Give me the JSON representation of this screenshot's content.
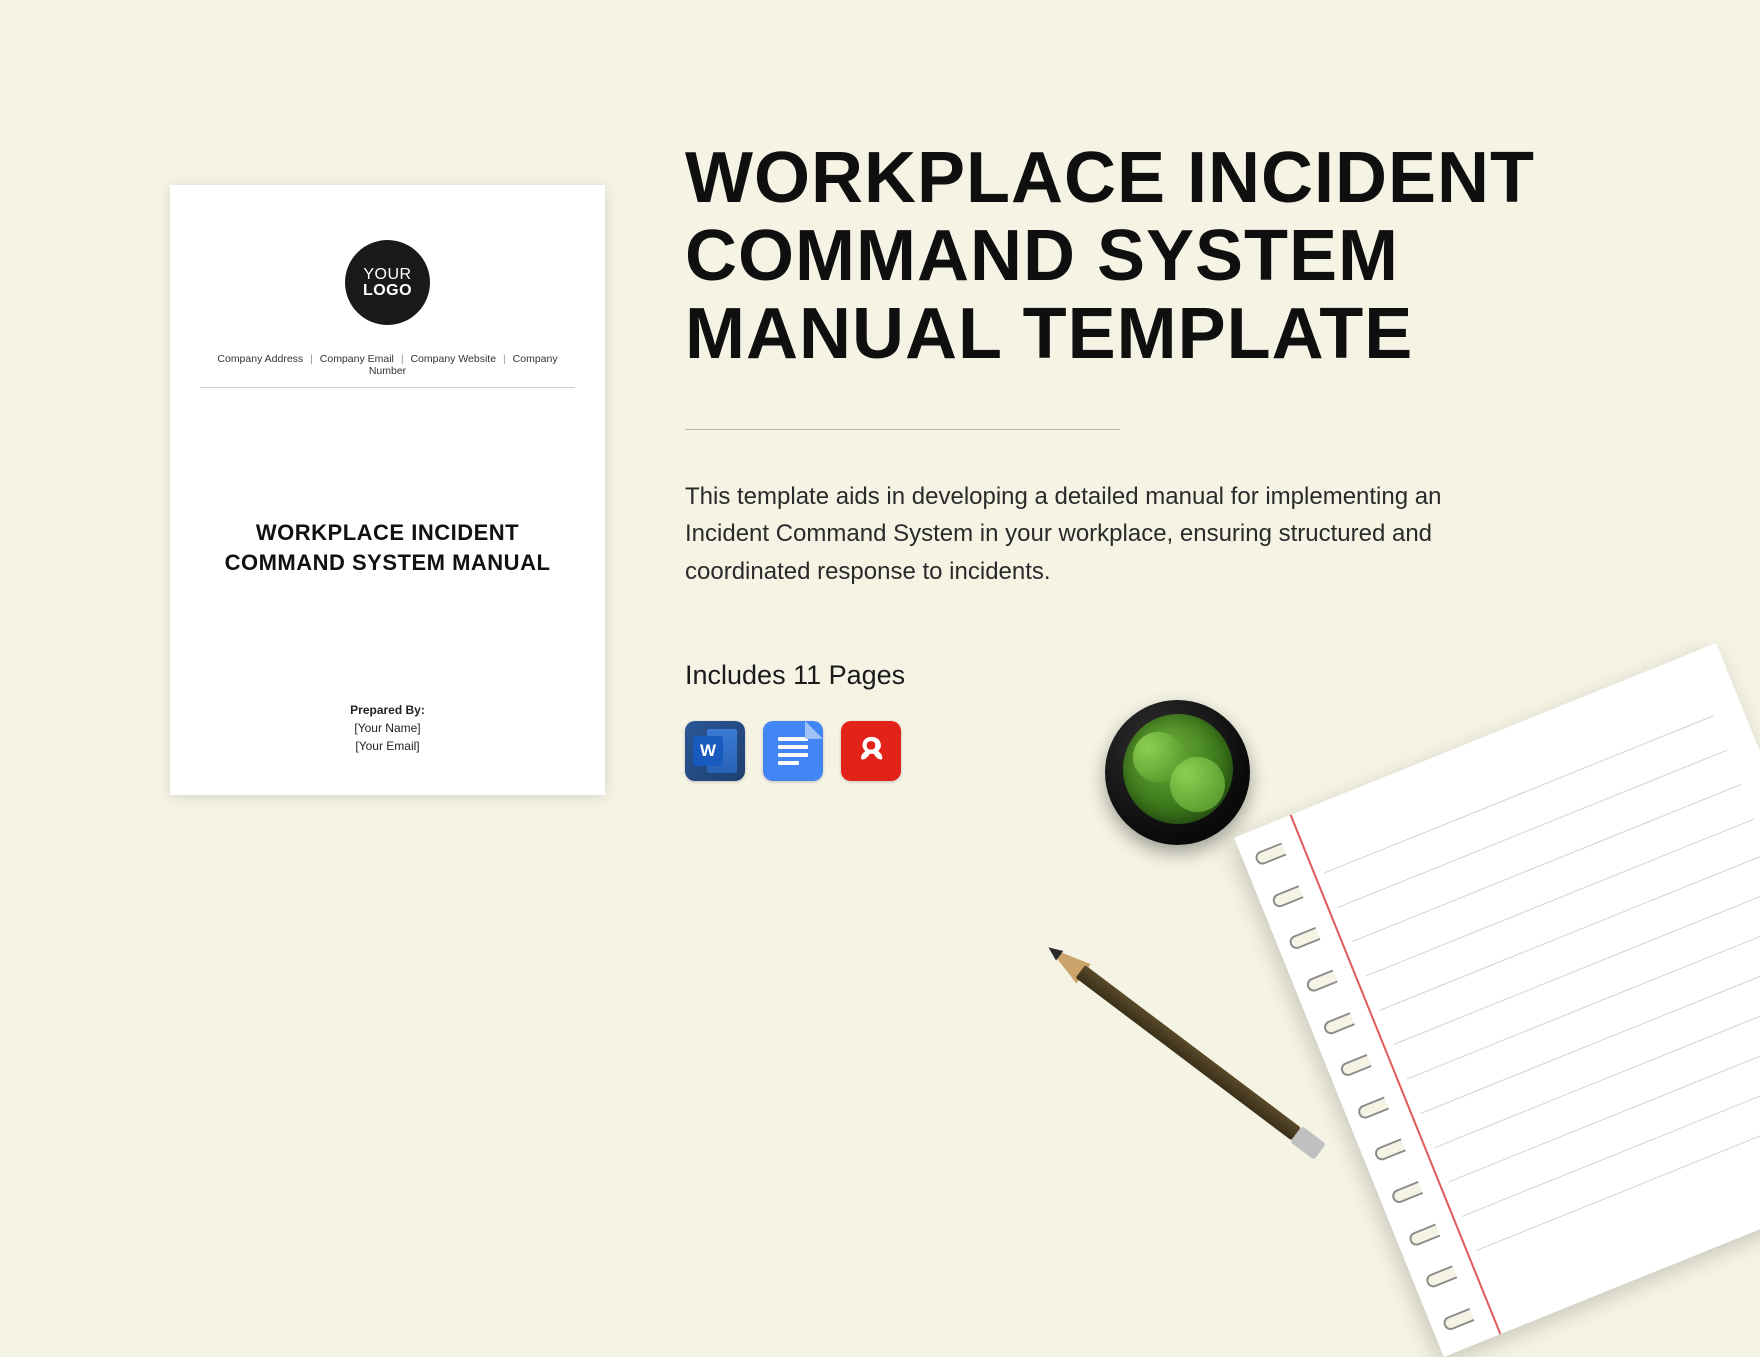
{
  "document_preview": {
    "logo": {
      "line1": "YOUR",
      "line2": "LOGO"
    },
    "meta": {
      "address": "Company Address",
      "email": "Company Email",
      "website": "Company Website",
      "number": "Company Number"
    },
    "title_line1": "WORKPLACE INCIDENT",
    "title_line2": "COMMAND SYSTEM MANUAL",
    "prepared_label": "Prepared By:",
    "prepared_name": "[Your Name]",
    "prepared_email": "[Your Email]"
  },
  "headline": "WORKPLACE INCIDENT COMMAND SYSTEM MANUAL TEMPLATE",
  "description": "This template aids in developing a detailed manual for implementing an Incident Command System in your workplace, ensuring structured and coordinated response to incidents.",
  "includes_label": "Includes 11 Pages",
  "file_formats": {
    "word": "W",
    "google_docs": "google-docs",
    "pdf": "pdf"
  },
  "decor": {
    "plant": "potted-plant",
    "notepad": "spiral-notepad",
    "pencil": "pencil"
  }
}
